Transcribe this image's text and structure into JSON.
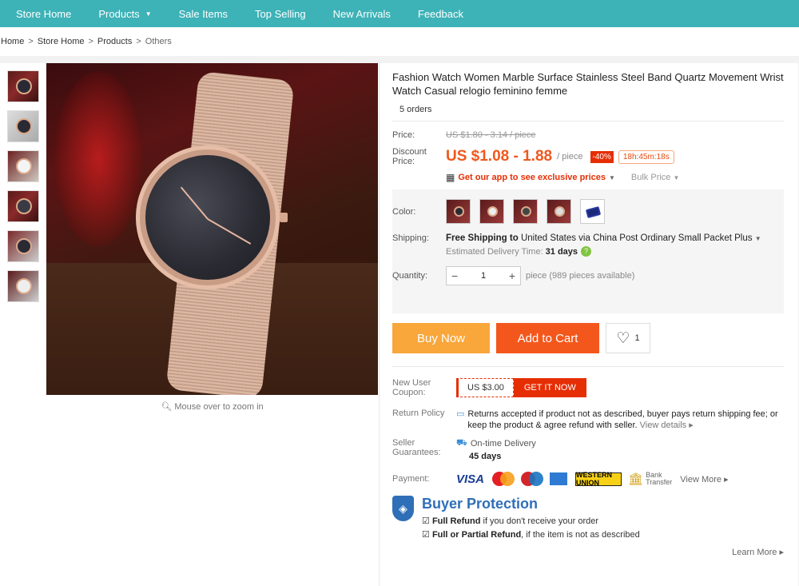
{
  "nav": {
    "items": [
      "Store Home",
      "Products",
      "Sale Items",
      "Top Selling",
      "New Arrivals",
      "Feedback"
    ]
  },
  "breadcrumb": [
    "Home",
    "Store Home",
    "Products",
    "Others"
  ],
  "gallery": {
    "zoom_hint": "Mouse over to zoom in",
    "thumbnails": 6
  },
  "product": {
    "title": "Fashion Watch Women Marble Surface Stainless Steel Band Quartz Movement Wrist Watch Casual relogio feminino femme",
    "orders": "5 orders",
    "price_label": "Price:",
    "original_price": "US $1.80 - 3.14 / piece",
    "discount_label_1": "Discount",
    "discount_label_2": "Price:",
    "discount_price": "US $1.08 - 1.88",
    "per_piece": "/ piece",
    "discount_pct": "-40%",
    "countdown": "18h:45m:18s",
    "app_link": "Get our app to see exclusive prices",
    "bulk_price": "Bulk Price"
  },
  "options": {
    "color_label": "Color:",
    "shipping_label": "Shipping:",
    "shipping_bold": "Free Shipping to",
    "shipping_rest": "United States via China Post Ordinary Small Packet Plus",
    "eta_label": "Estimated Delivery Time:",
    "eta_value": "31  days",
    "quantity_label": "Quantity:",
    "quantity_value": "1",
    "quantity_unit": "piece (989 pieces available)"
  },
  "actions": {
    "buy_now": "Buy Now",
    "add_to_cart": "Add to Cart",
    "wishlist_count": "1"
  },
  "coupon": {
    "label_1": "New User",
    "label_2": "Coupon:",
    "value": "US $3.00",
    "button": "GET IT NOW"
  },
  "return_policy": {
    "label": "Return Policy",
    "text": "Returns accepted if product not as described, buyer pays return shipping fee; or keep the product & agree refund with seller.",
    "link": "View details"
  },
  "seller_guarantees": {
    "label_1": "Seller",
    "label_2": "Guarantees:",
    "text": "On-time Delivery",
    "days": "45 days"
  },
  "payment": {
    "label": "Payment:",
    "visa": "VISA",
    "western_union": "WESTERN UNION",
    "bank_1": "Bank",
    "bank_2": "Transfer",
    "view_more": "View More"
  },
  "buyer_protection": {
    "title": "Buyer Protection",
    "line1_bold": "Full Refund",
    "line1_rest": "if you don't receive your order",
    "line2_bold": "Full or Partial Refund",
    "line2_rest": ", if the item is not as described",
    "learn_more": "Learn More"
  },
  "colors": {
    "nav_bg": "#3db2b7",
    "price": "#f0571c",
    "buy_now": "#f9a63a",
    "add_to_cart": "#f4571c",
    "accent_red": "#e62e04",
    "protection_blue": "#2f6fb7"
  }
}
